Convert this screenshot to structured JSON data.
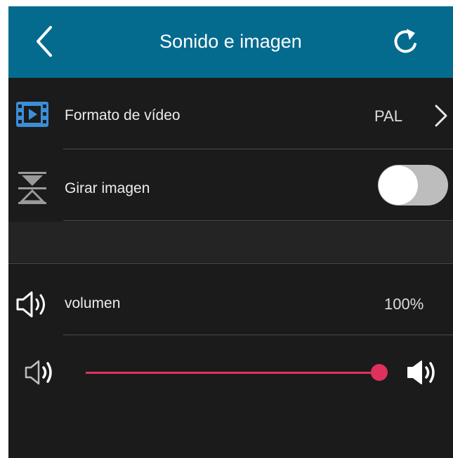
{
  "header": {
    "title": "Sonido e imagen",
    "back_icon": "chevron-left-icon",
    "refresh_icon": "refresh-icon"
  },
  "settings": {
    "video_format": {
      "label": "Formato de vídeo",
      "value": "PAL",
      "icon": "film-icon"
    },
    "rotate_image": {
      "label": "Girar imagen",
      "enabled": false,
      "icon": "flip-icon"
    },
    "volume": {
      "label": "volumen",
      "value": "100%",
      "icon": "speaker-icon"
    }
  },
  "volume_slider": {
    "level": 1.0,
    "min_icon": "volume-low-icon",
    "max_icon": "volume-high-icon"
  },
  "colors": {
    "header_bg": "#046b8f",
    "screen_bg": "#1b1b1b",
    "accent": "#e0305e",
    "film_icon": "#3b8fd9"
  }
}
